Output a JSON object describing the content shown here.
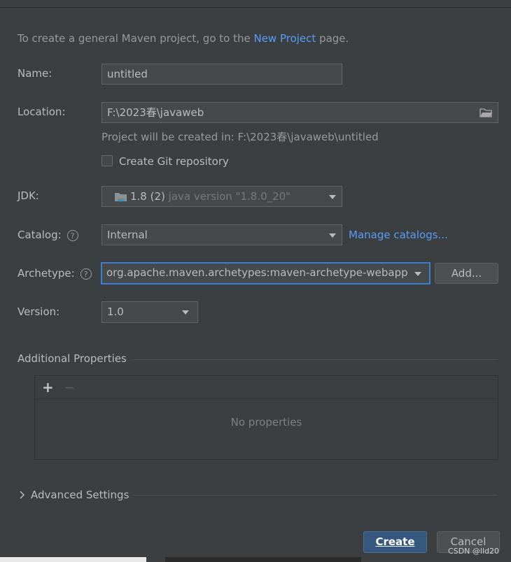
{
  "hint": {
    "text_before": "To create a general Maven project, go to the ",
    "link": "New Project",
    "text_after": " page."
  },
  "name": {
    "label": "Name:",
    "value": "untitled"
  },
  "location": {
    "label": "Location:",
    "value": "F:\\2023春\\javaweb",
    "subtext": "Project will be created in: F:\\2023春\\javaweb\\untitled"
  },
  "git": {
    "label": "Create Git repository",
    "checked": false
  },
  "jdk": {
    "label": "JDK:",
    "version": "1.8 (2)",
    "detail": "java version \"1.8.0_20\""
  },
  "catalog": {
    "label": "Catalog:",
    "value": "Internal",
    "manage_link": "Manage catalogs..."
  },
  "archetype": {
    "label": "Archetype:",
    "value": "org.apache.maven.archetypes:maven-archetype-webapp",
    "add_button": "Add..."
  },
  "version": {
    "label": "Version:",
    "value": "1.0"
  },
  "additional": {
    "title": "Additional Properties",
    "add": "+",
    "remove": "−",
    "empty": "No properties"
  },
  "advanced": {
    "title": "Advanced Settings"
  },
  "footer": {
    "create": "Create",
    "cancel": "Cancel"
  },
  "watermark": "CSDN @lld20",
  "colors": {
    "background": "#3c3f41",
    "link": "#589df6",
    "focus": "#3d7dd6",
    "primary": "#365880"
  }
}
